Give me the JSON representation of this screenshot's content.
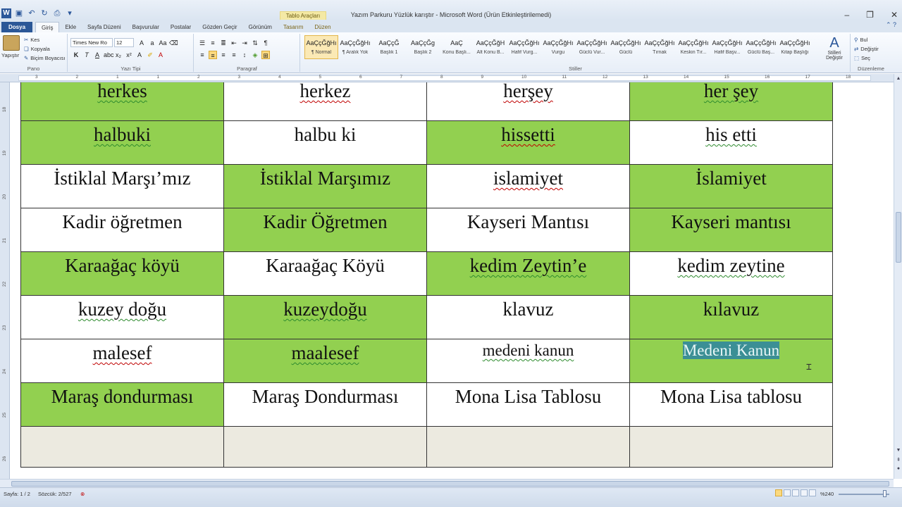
{
  "window": {
    "title": "Yazım Parkuru Yüzlük karıştır  -  Microsoft Word (Ürün Etkinleştirilemedi)",
    "context_tab_group": "Tablo Araçları",
    "controls": [
      "minimize-icon",
      "maximize-icon",
      "close-icon"
    ]
  },
  "qat": [
    "word-icon",
    "save-icon",
    "undo-icon",
    "redo-icon",
    "print-icon",
    "customize-icon"
  ],
  "tabs": {
    "file": "Dosya",
    "items": [
      "Giriş",
      "Ekle",
      "Sayfa Düzeni",
      "Başvurular",
      "Postalar",
      "Gözden Geçir",
      "Görünüm",
      "Tasarım",
      "Düzen"
    ],
    "active": "Giriş"
  },
  "ribbon": {
    "clipboard": {
      "label": "Pano",
      "paste": "Yapıştır",
      "cut": "Kes",
      "copy": "Kopyala",
      "format_painter": "Biçim Boyacısı"
    },
    "font": {
      "label": "Yazı Tipi",
      "font_name": "Times New Ro",
      "font_size": "12"
    },
    "paragraph": {
      "label": "Paragraf"
    },
    "styles": {
      "label": "Stiller",
      "items": [
        {
          "sample": "AaÇçĞğHı",
          "name": "¶ Normal"
        },
        {
          "sample": "AaÇçĞğHı",
          "name": "¶ Aralık Yok"
        },
        {
          "sample": "AaÇçĞ",
          "name": "Başlık 1"
        },
        {
          "sample": "AaÇçĞg",
          "name": "Başlık 2"
        },
        {
          "sample": "AaÇ",
          "name": "Konu Başlı..."
        },
        {
          "sample": "AaÇçĞğH",
          "name": "Alt Konu B..."
        },
        {
          "sample": "AaÇçĞğHı",
          "name": "Hafif Vurg..."
        },
        {
          "sample": "AaÇçĞğHı",
          "name": "Vurgu"
        },
        {
          "sample": "AaÇçĞğHı",
          "name": "Güclü Vur..."
        },
        {
          "sample": "AaÇçĞğHı",
          "name": "Güclü"
        },
        {
          "sample": "AaÇçĞğHı",
          "name": "Tırnak"
        },
        {
          "sample": "AaÇçĞğHı",
          "name": "Keskin Tır..."
        },
        {
          "sample": "AaÇçĞğHı",
          "name": "Hafif Başv..."
        },
        {
          "sample": "AaÇçĞğHı",
          "name": "Güclü Baş..."
        },
        {
          "sample": "AaÇçĞğHı",
          "name": "Kitap Başlığı"
        }
      ],
      "change_styles": "Stilleri Değiştir"
    },
    "editing": {
      "label": "Düzenleme",
      "find": "Bul",
      "replace": "Değiştir",
      "select": "Seç"
    }
  },
  "ruler": {
    "h_numbers": [
      "3",
      "2",
      "1",
      "1",
      "2",
      "3",
      "4",
      "5",
      "6",
      "7",
      "8",
      "9",
      "10",
      "11",
      "12",
      "13",
      "14",
      "15",
      "16",
      "17",
      "18"
    ],
    "v_numbers": [
      "18",
      "19",
      "20",
      "21",
      "22",
      "23",
      "24",
      "25",
      "26"
    ]
  },
  "table": {
    "rows": [
      [
        "herkes",
        "herkez",
        "herşey",
        "her şey"
      ],
      [
        "halbuki",
        "halbu ki",
        "hissetti",
        "his etti"
      ],
      [
        "İstiklal Marşı’mız",
        "İstiklal Marşımız",
        "islamiyet",
        "İslamiyet"
      ],
      [
        "Kadir öğretmen",
        "Kadir Öğretmen",
        "Kayseri Mantısı",
        "Kayseri mantısı"
      ],
      [
        "Karaağaç köyü",
        "Karaağaç Köyü",
        "kedim Zeytin’e",
        "kedim zeytine"
      ],
      [
        "kuzey doğu",
        "kuzeydoğu",
        "klavuz",
        "kılavuz"
      ],
      [
        "malesef",
        "maalesef",
        "medeni kanun",
        "Medeni Kanun"
      ],
      [
        "Maraş dondurması",
        "Maraş Dondurması",
        "Mona Lisa Tablosu",
        "Mona Lisa tablosu"
      ],
      [
        "",
        "",
        "",
        ""
      ]
    ],
    "green_fill": "#92d050"
  },
  "status": {
    "page": "Sayfa: 1 / 2",
    "words": "Sözcük: 2/527",
    "zoom": "%240"
  }
}
